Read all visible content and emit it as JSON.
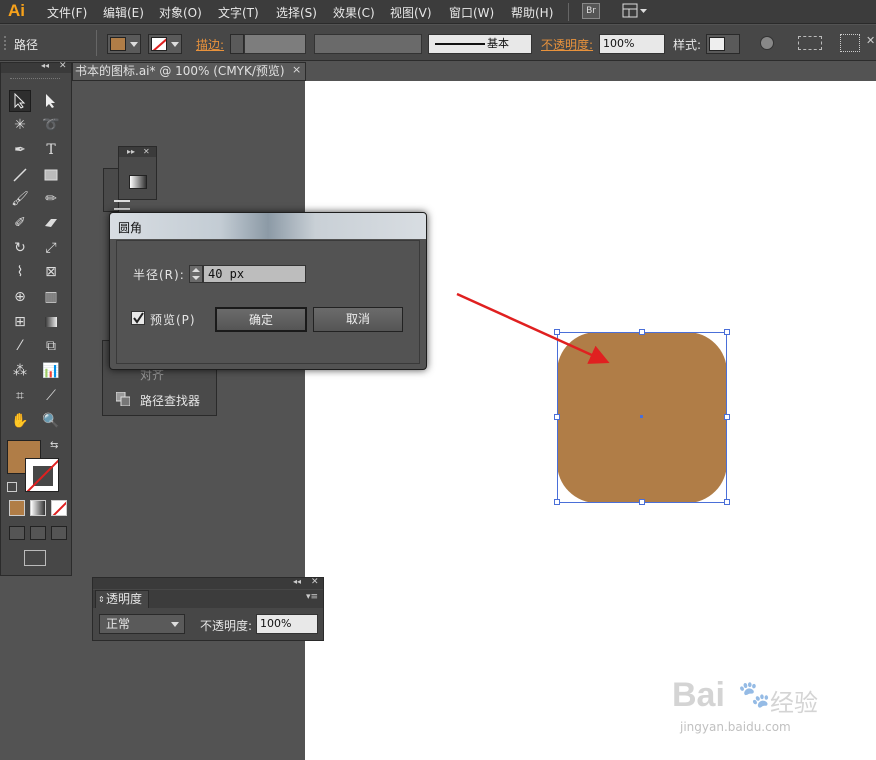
{
  "app": {
    "logo": "Ai"
  },
  "menu": [
    "文件(F)",
    "编辑(E)",
    "对象(O)",
    "文字(T)",
    "选择(S)",
    "效果(C)",
    "视图(V)",
    "窗口(W)",
    "帮助(H)"
  ],
  "bridge_label": "Br",
  "control_bar": {
    "selection_label": "路径",
    "stroke_label": "描边:",
    "brush_style": "基本",
    "opacity_label": "不透明度:",
    "opacity_value": "100%",
    "style_label": "样式:"
  },
  "document_tab": {
    "title": "书本的图标.ai* @ 100% (CMYK/预览)",
    "close": "×"
  },
  "colors": {
    "fill": "#b07d47",
    "accent": "#f7a21b",
    "selection": "#4a6fd8",
    "annotation_arrow": "#e02020"
  },
  "tools": [
    "selection-icon",
    "direct-selection-icon",
    "magic-wand-icon",
    "lasso-icon",
    "pen-icon",
    "type-icon",
    "line-icon",
    "rectangle-icon",
    "paintbrush-icon",
    "pencil-icon",
    "blob-brush-icon",
    "eraser-icon",
    "rotate-icon",
    "scale-icon",
    "warp-icon",
    "free-transform-icon",
    "shape-builder-icon",
    "perspective-grid-icon",
    "mesh-icon",
    "gradient-icon",
    "eyedropper-icon",
    "blend-icon",
    "symbol-sprayer-icon",
    "column-graph-icon",
    "artboard-icon",
    "slice-icon",
    "hand-icon",
    "zoom-icon"
  ],
  "panels": {
    "pathfinder_label": "路径查找器",
    "align_label": "对齐"
  },
  "dialog": {
    "title": "圆角",
    "radius_label": "半径(R):",
    "radius_value": "40 px",
    "preview_label": "预览(P)",
    "preview_checked": true,
    "ok_label": "确定",
    "cancel_label": "取消"
  },
  "transparency_panel": {
    "tab_label": "透明度",
    "blend_mode": "正常",
    "opacity_label": "不透明度:",
    "opacity_value": "100%"
  },
  "watermark": {
    "brand": "Bai",
    "brand_cn": "经验",
    "url": "jingyan.baidu.com"
  }
}
